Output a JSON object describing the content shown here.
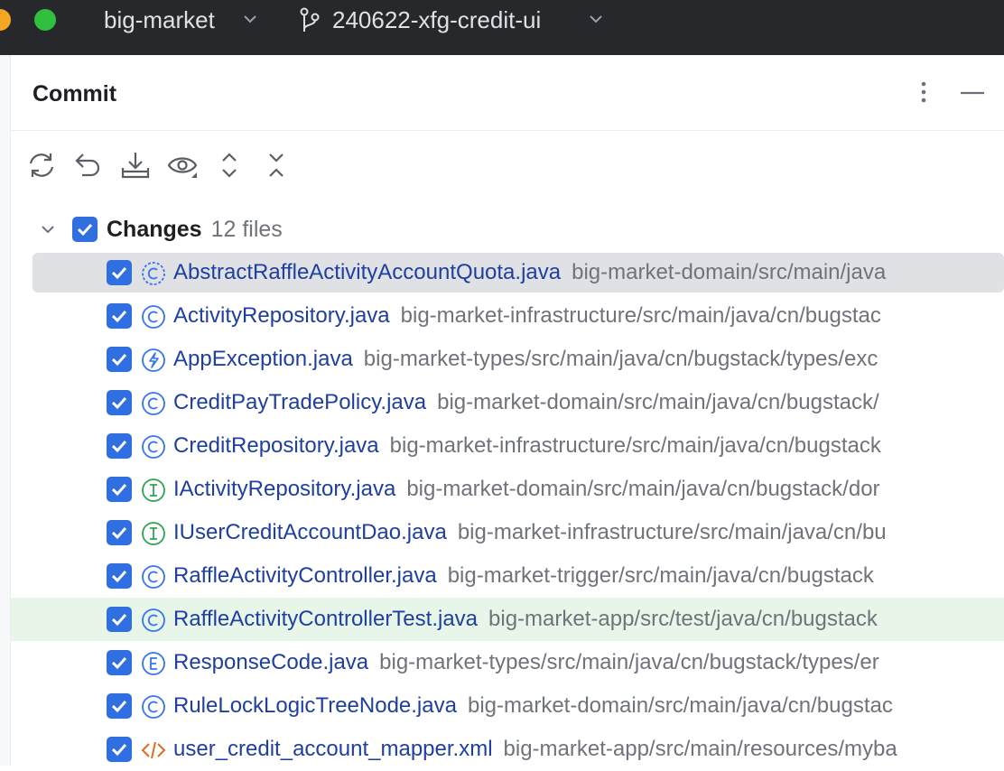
{
  "titlebar": {
    "project": "big-market",
    "branch": "240622-xfg-credit-ui",
    "traffic_colors": [
      "#f5a623",
      "#2fc13e"
    ]
  },
  "panel": {
    "title": "Commit"
  },
  "toolbar": {
    "icons": [
      "refresh-icon",
      "rollback-icon",
      "shelve-icon",
      "preview-icon",
      "expand-all-icon",
      "collapse-all-icon"
    ]
  },
  "changes": {
    "label": "Changes",
    "count": "12 files",
    "files": [
      {
        "name": "AbstractRaffleActivityAccountQuota.java",
        "path": "big-market-domain/src/main/java",
        "icon": "abstract-class-icon",
        "state": "selected"
      },
      {
        "name": "ActivityRepository.java",
        "path": "big-market-infrastructure/src/main/java/cn/bugstac",
        "icon": "class-icon",
        "state": ""
      },
      {
        "name": "AppException.java",
        "path": "big-market-types/src/main/java/cn/bugstack/types/exc",
        "icon": "exception-icon",
        "state": ""
      },
      {
        "name": "CreditPayTradePolicy.java",
        "path": "big-market-domain/src/main/java/cn/bugstack/",
        "icon": "class-icon",
        "state": ""
      },
      {
        "name": "CreditRepository.java",
        "path": "big-market-infrastructure/src/main/java/cn/bugstack",
        "icon": "class-icon",
        "state": ""
      },
      {
        "name": "IActivityRepository.java",
        "path": "big-market-domain/src/main/java/cn/bugstack/dor",
        "icon": "interface-icon",
        "state": ""
      },
      {
        "name": "IUserCreditAccountDao.java",
        "path": "big-market-infrastructure/src/main/java/cn/bu",
        "icon": "interface-icon",
        "state": ""
      },
      {
        "name": "RaffleActivityController.java",
        "path": "big-market-trigger/src/main/java/cn/bugstack",
        "icon": "class-icon",
        "state": ""
      },
      {
        "name": "RaffleActivityControllerTest.java",
        "path": "big-market-app/src/test/java/cn/bugstack",
        "icon": "class-icon",
        "state": "highlight"
      },
      {
        "name": "ResponseCode.java",
        "path": "big-market-types/src/main/java/cn/bugstack/types/er",
        "icon": "enum-icon",
        "state": ""
      },
      {
        "name": "RuleLockLogicTreeNode.java",
        "path": "big-market-domain/src/main/java/cn/bugstac",
        "icon": "class-icon",
        "state": ""
      },
      {
        "name": "user_credit_account_mapper.xml",
        "path": "big-market-app/src/main/resources/myba",
        "icon": "xml-icon",
        "state": ""
      }
    ]
  }
}
